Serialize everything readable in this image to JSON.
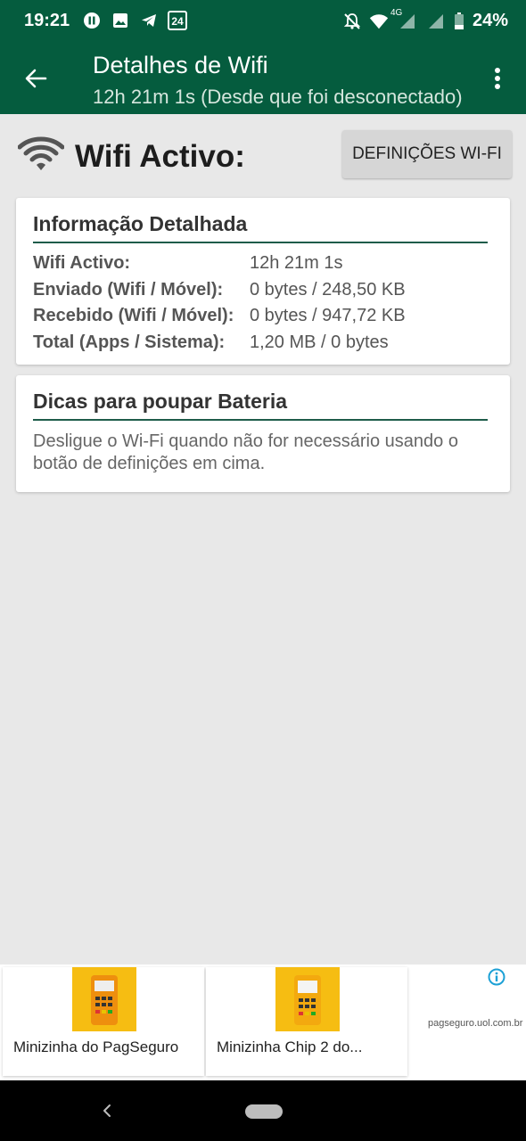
{
  "status_bar": {
    "time": "19:21",
    "left_icons": [
      "pause-circle-icon",
      "image-icon",
      "telegram-icon",
      "24-badge-icon"
    ],
    "right_icons": [
      "bell-off-icon",
      "wifi-signal-icon",
      "cell-signal-icon",
      "cell-signal-icon",
      "battery-icon"
    ],
    "network_type": "4G",
    "battery": "24%"
  },
  "app_bar": {
    "title": "Detalhes de Wifi",
    "subtitle": "12h 21m 1s (Desde que foi desconectado)",
    "back_icon": "arrow-left-icon",
    "menu_icon": "more-vert-icon"
  },
  "wifi_status": {
    "label": "Wifi Activo:",
    "settings_button": "DEFINIÇÕES WI-FI"
  },
  "info_card": {
    "title": "Informação Detalhada",
    "rows": [
      {
        "key": "Wifi Activo:",
        "value": "12h 21m 1s"
      },
      {
        "key": "Enviado (Wifi / Móvel):",
        "value": "0 bytes / 248,50 KB"
      },
      {
        "key": "Recebido (Wifi / Móvel):",
        "value": "0 bytes / 947,72 KB"
      },
      {
        "key": "Total (Apps / Sistema):",
        "value": "1,20 MB / 0 bytes"
      }
    ]
  },
  "tips_card": {
    "title": "Dicas para poupar Bateria",
    "text": "Desligue o Wi-Fi quando não for necessário usando o botão de definições em cima."
  },
  "ads": {
    "items": [
      {
        "caption": "Minizinha do PagSeguro"
      },
      {
        "caption": "Minizinha Chip 2 do..."
      }
    ],
    "domain": "pagseguro.uol.com.br"
  },
  "colors": {
    "primary": "#055c3e",
    "accent_rule": "#1e5c4a",
    "background": "#e8e8e8",
    "ad_product": "#f6bd12"
  }
}
